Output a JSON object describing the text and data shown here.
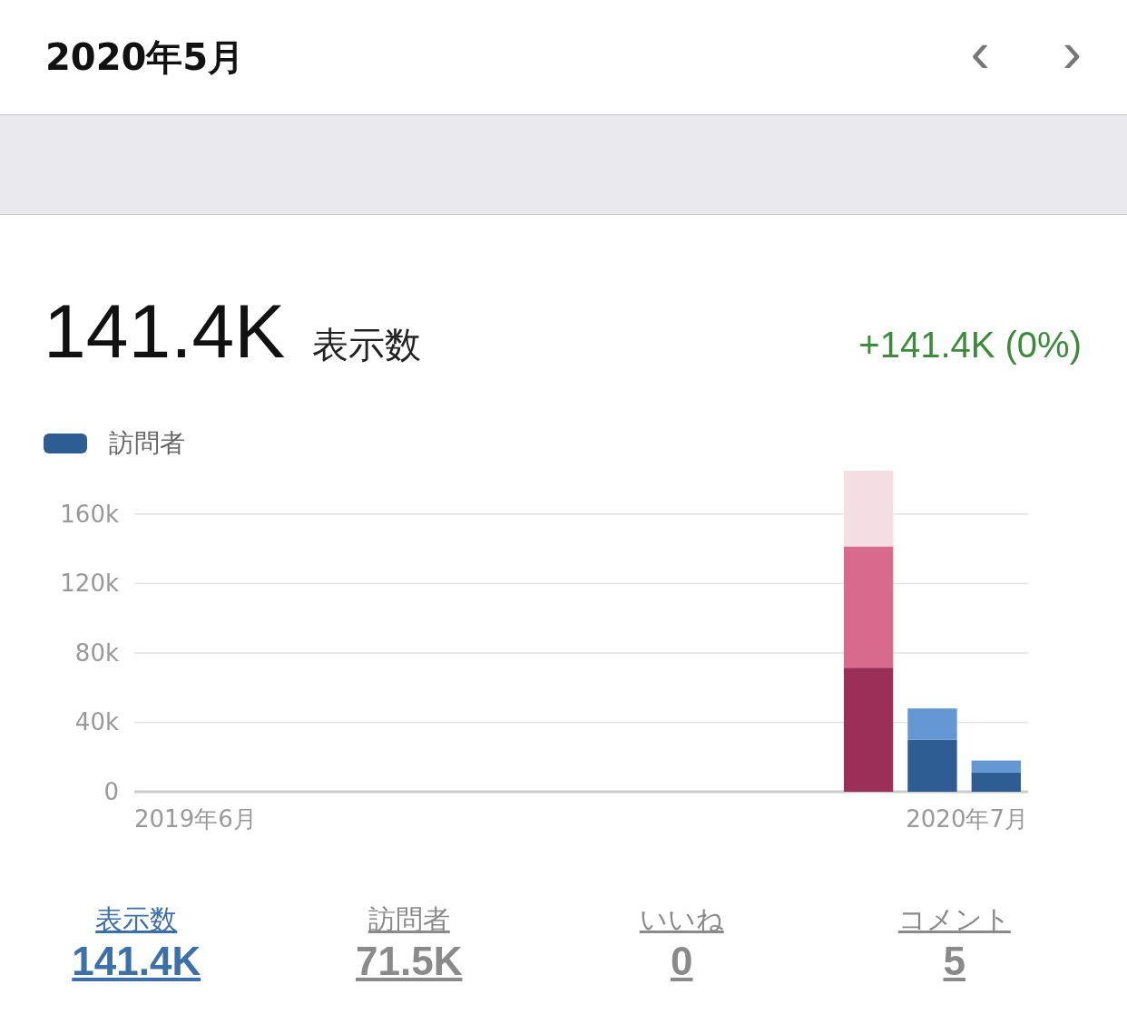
{
  "header": {
    "title": "2020年5月",
    "prev": "‹",
    "next": "›"
  },
  "summary": {
    "value": "141.4K",
    "label": "表示数",
    "change": "+141.4K (0%)"
  },
  "chart_data": {
    "type": "bar",
    "stacked": true,
    "grid": true,
    "categories": [
      "2019年6月",
      null,
      null,
      null,
      null,
      null,
      null,
      null,
      null,
      null,
      null,
      null,
      null,
      "2020年7月"
    ],
    "series": [
      {
        "name": "訪問者",
        "color": "#2e5d93",
        "values": [
          0,
          0,
          0,
          0,
          0,
          0,
          0,
          0,
          0,
          0,
          0,
          0,
          30000,
          11000
        ]
      },
      {
        "color": "#6497d4",
        "values": [
          0,
          0,
          0,
          0,
          0,
          0,
          0,
          0,
          0,
          0,
          0,
          0,
          18000,
          7000
        ]
      },
      {
        "color": "#9c2f57",
        "values": [
          0,
          0,
          0,
          0,
          0,
          0,
          0,
          0,
          0,
          0,
          0,
          71500,
          0,
          0
        ]
      },
      {
        "color": "#d86b8d",
        "values": [
          0,
          0,
          0,
          0,
          0,
          0,
          0,
          0,
          0,
          0,
          0,
          69900,
          0,
          0
        ]
      },
      {
        "color": "#f5dde4",
        "values": [
          0,
          0,
          0,
          0,
          0,
          0,
          0,
          0,
          0,
          0,
          0,
          43600,
          0,
          0
        ]
      }
    ],
    "ylim": [
      0,
      185000
    ],
    "yticks": [
      {
        "value": 0,
        "label": "0"
      },
      {
        "value": 40000,
        "label": "40k"
      },
      {
        "value": 80000,
        "label": "80k"
      },
      {
        "value": 120000,
        "label": "120k"
      },
      {
        "value": 160000,
        "label": "160k"
      }
    ]
  },
  "stats": [
    {
      "label": "表示数",
      "value": "141.4K",
      "selected": true
    },
    {
      "label": "訪問者",
      "value": "71.5K",
      "selected": false
    },
    {
      "label": "いいね",
      "value": "0",
      "selected": false
    },
    {
      "label": "コメント",
      "value": "5",
      "selected": false
    }
  ]
}
